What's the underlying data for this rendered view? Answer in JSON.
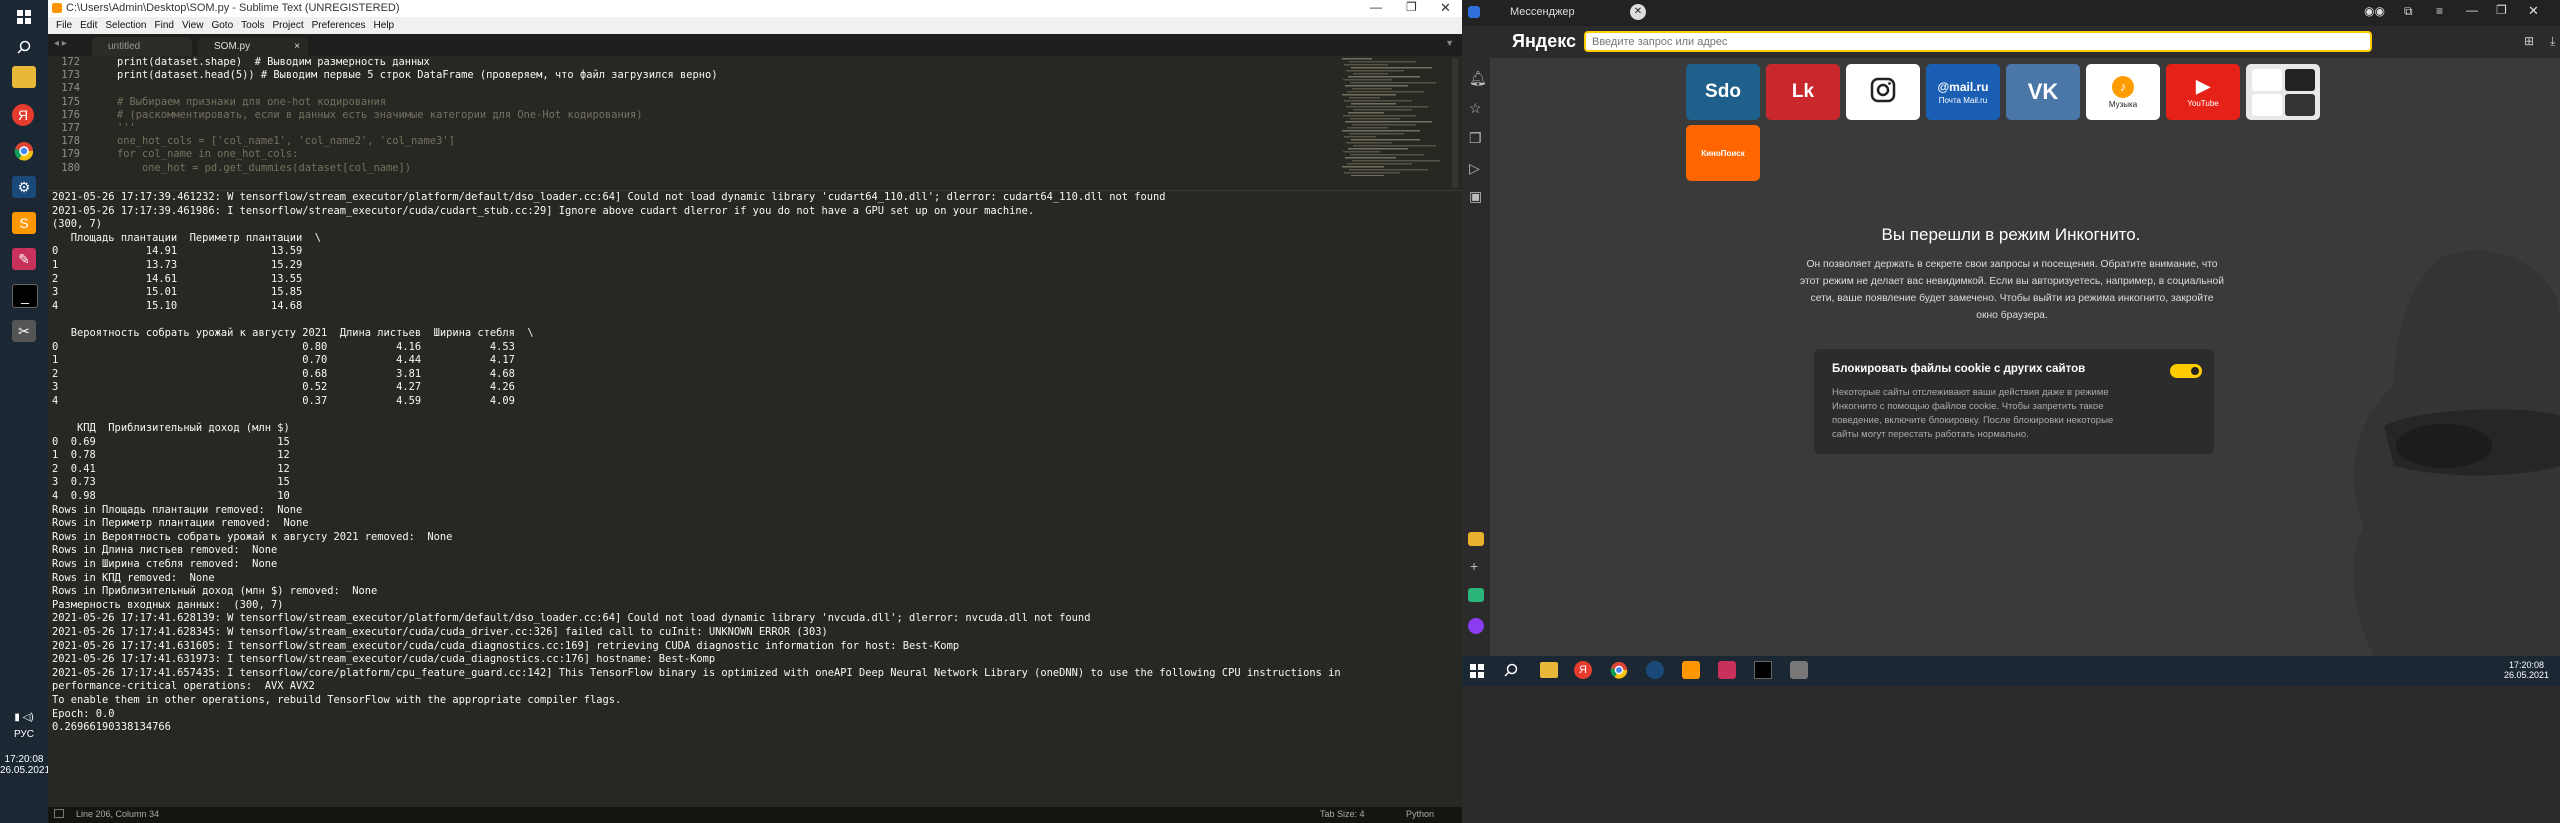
{
  "taskbar_left": {
    "icons": [
      "windows-icon",
      "search-icon",
      "file-explorer-icon",
      "yandex-browser-icon",
      "chrome-icon",
      "steam-icon",
      "sublime-icon",
      "task-icon",
      "terminal-icon",
      "snipping-icon"
    ],
    "tray": {
      "language": "РУС",
      "time": "17:20:08",
      "date": "26.05.2021"
    }
  },
  "sublime": {
    "title": "C:\\Users\\Admin\\Desktop\\SOM.py - Sublime Text (UNREGISTERED)",
    "menu": [
      "File",
      "Edit",
      "Selection",
      "Find",
      "View",
      "Goto",
      "Tools",
      "Project",
      "Preferences",
      "Help"
    ],
    "tabs": [
      {
        "label": "untitled",
        "active": false
      },
      {
        "label": "SOM.py",
        "active": true
      }
    ],
    "editor_lines": [
      {
        "n": "172",
        "text": "    print(dataset.shape)  # Выводим размерность данных",
        "comment": false
      },
      {
        "n": "173",
        "text": "    print(dataset.head(5)) # Выводим первые 5 строк DataFrame (проверяем, что файл загрузился верно)",
        "comment": false
      },
      {
        "n": "174",
        "text": "",
        "comment": false
      },
      {
        "n": "175",
        "text": "    # Выбираем признаки для one-hot кодирования",
        "comment": true
      },
      {
        "n": "176",
        "text": "    # (раскомментировать, если в данных есть значимые категории для One-Hot кодирования)",
        "comment": true
      },
      {
        "n": "177",
        "text": "    '''",
        "comment": true
      },
      {
        "n": "178",
        "text": "    one_hot_cols = ['col_name1', 'col_name2', 'col_name3']",
        "comment": true
      },
      {
        "n": "179",
        "text": "    for col_name in one_hot_cols:",
        "comment": true
      },
      {
        "n": "180",
        "text": "        one_hot = pd.get_dummies(dataset[col_name])",
        "comment": true
      }
    ],
    "console_lines": [
      "2021-05-26 17:17:39.461232: W tensorflow/stream_executor/platform/default/dso_loader.cc:64] Could not load dynamic library 'cudart64_110.dll'; dlerror: cudart64_110.dll not found",
      "2021-05-26 17:17:39.461986: I tensorflow/stream_executor/cuda/cudart_stub.cc:29] Ignore above cudart dlerror if you do not have a GPU set up on your machine.",
      "(300, 7)",
      "   Площадь плантации  Периметр плантации  \\",
      "0              14.91               13.59",
      "1              13.73               15.29",
      "2              14.61               13.55",
      "3              15.01               15.85",
      "4              15.10               14.68",
      "",
      "   Вероятность собрать урожай к августу 2021  Длина листьев  Ширина стебля  \\",
      "0                                       0.80           4.16           4.53",
      "1                                       0.70           4.44           4.17",
      "2                                       0.68           3.81           4.68",
      "3                                       0.52           4.27           4.26",
      "4                                       0.37           4.59           4.09",
      "",
      "    КПД  Приблизительный доход (млн $)",
      "0  0.69                             15",
      "1  0.78                             12",
      "2  0.41                             12",
      "3  0.73                             15",
      "4  0.98                             10",
      "Rows in Площадь плантации removed:  None",
      "Rows in Периметр плантации removed:  None",
      "Rows in Вероятность собрать урожай к августу 2021 removed:  None",
      "Rows in Длина листьев removed:  None",
      "Rows in Ширина стебля removed:  None",
      "Rows in КПД removed:  None",
      "Rows in Приблизительный доход (млн $) removed:  None",
      "Размерность входных данных:  (300, 7)",
      "2021-05-26 17:17:41.628139: W tensorflow/stream_executor/platform/default/dso_loader.cc:64] Could not load dynamic library 'nvcuda.dll'; dlerror: nvcuda.dll not found",
      "2021-05-26 17:17:41.628345: W tensorflow/stream_executor/cuda/cuda_driver.cc:326] failed call to cuInit: UNKNOWN ERROR (303)",
      "2021-05-26 17:17:41.631605: I tensorflow/stream_executor/cuda/cuda_diagnostics.cc:169] retrieving CUDA diagnostic information for host: Best-Komp",
      "2021-05-26 17:17:41.631973: I tensorflow/stream_executor/cuda/cuda_diagnostics.cc:176] hostname: Best-Komp",
      "2021-05-26 17:17:41.657435: I tensorflow/core/platform/cpu_feature_guard.cc:142] This TensorFlow binary is optimized with oneAPI Deep Neural Network Library (oneDNN) to use the following CPU instructions in",
      "performance-critical operations:  AVX AVX2",
      "To enable them in other operations, rebuild TensorFlow with the appropriate compiler flags.",
      "Epoch: 0.0",
      "0.26966190338134766"
    ],
    "status": {
      "position": "Line 206, Column 34",
      "tab_size": "Tab Size: 4",
      "syntax": "Python"
    }
  },
  "browser": {
    "tab_title": "Мессенджер",
    "brand": "Яндекс",
    "search_placeholder": "Введите запрос или адрес",
    "tiles": [
      {
        "label": "Sdo",
        "caption": "",
        "color": "#1e5f8c"
      },
      {
        "label": "Lk",
        "caption": "",
        "color": "#c8282c"
      },
      {
        "label": "◎",
        "caption": "",
        "color": "#ffffff"
      },
      {
        "label": "@mail.ru",
        "caption": "Почта Mail.ru",
        "color": "#1a5fb4"
      },
      {
        "label": "VK",
        "caption": "",
        "color": "#4a76a8"
      },
      {
        "label": "♪",
        "caption": "Музыка",
        "color": "#ffffff"
      },
      {
        "label": "▶",
        "caption": "YouTube",
        "color": "#e62117"
      },
      {
        "label": "",
        "caption": "",
        "color": "#e8e8e8"
      },
      {
        "label": "КиноПоиск",
        "caption": "",
        "color": "#ff6600"
      }
    ],
    "incognito": {
      "title": "Вы перешли в режим Инкогнито.",
      "text": "Он позволяет держать в секрете свои запросы и посещения. Обратите внимание, что этот режим не делает вас невидимкой. Если вы авторизуетесь, например, в социальной сети, ваше появление будет замечено. Чтобы выйти из режима инкогнито, закройте окно браузера.",
      "cookie_title": "Блокировать файлы cookie с других сайтов",
      "cookie_text": "Некоторые сайты отслеживают ваши действия даже в режиме Инкогнито с помощью файлов cookie. Чтобы запретить такое поведение, включите блокировку. После блокировки некоторые сайты могут перестать работать нормально."
    }
  },
  "win_taskbar": {
    "time": "17:20:08",
    "date": "26.05.2021"
  }
}
